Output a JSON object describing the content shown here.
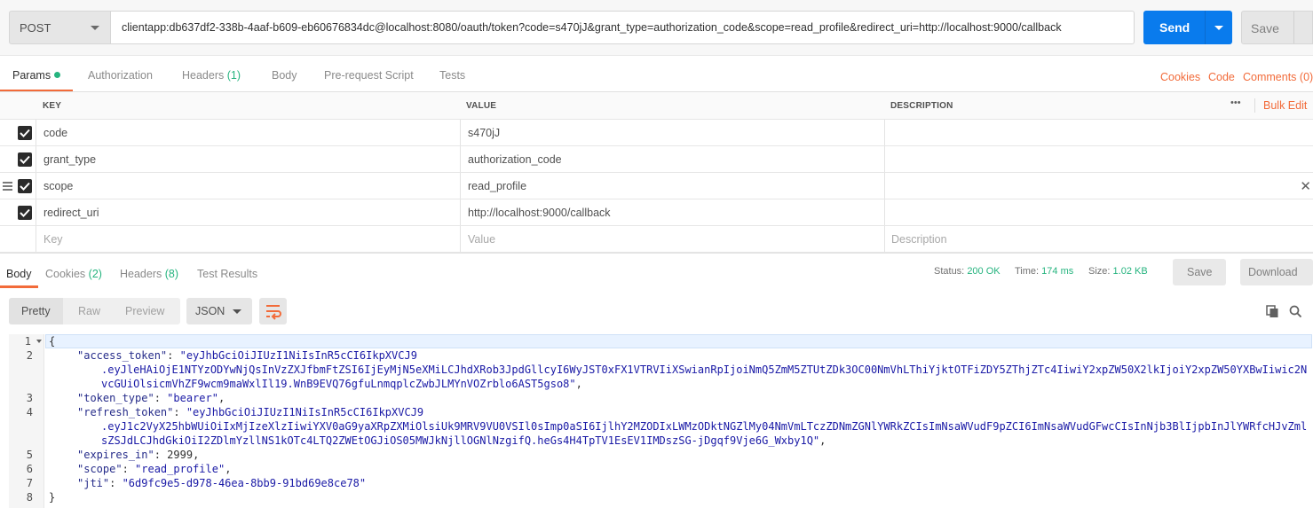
{
  "request": {
    "method": "POST",
    "url": "clientapp:db637df2-338b-4aaf-b609-eb60676834dc@localhost:8080/oauth/token?code=s470jJ&grant_type=authorization_code&scope=read_profile&redirect_uri=http://localhost:9000/callback",
    "send_label": "Send",
    "save_label": "Save"
  },
  "request_tabs": {
    "params": "Params",
    "authorization": "Authorization",
    "headers": "Headers",
    "headers_count": "(1)",
    "body": "Body",
    "prerequest": "Pre-request Script",
    "tests": "Tests"
  },
  "request_links": {
    "cookies": "Cookies",
    "code": "Code",
    "comments": "Comments (0)"
  },
  "params_table": {
    "headers": {
      "key": "KEY",
      "value": "VALUE",
      "description": "DESCRIPTION"
    },
    "bulk_edit": "Bulk Edit",
    "more": "•••",
    "rows": [
      {
        "key": "code",
        "value": "s470jJ"
      },
      {
        "key": "grant_type",
        "value": "authorization_code"
      },
      {
        "key": "scope",
        "value": "read_profile"
      },
      {
        "key": "redirect_uri",
        "value": "http://localhost:9000/callback"
      }
    ],
    "placeholders": {
      "key": "Key",
      "value": "Value",
      "description": "Description"
    }
  },
  "response_tabs": {
    "body": "Body",
    "cookies": "Cookies",
    "cookies_count": "(2)",
    "headers": "Headers",
    "headers_count": "(8)",
    "tests": "Test Results"
  },
  "response_status": {
    "status_label": "Status:",
    "status_value": "200 OK",
    "time_label": "Time:",
    "time_value": "174 ms",
    "size_label": "Size:",
    "size_value": "1.02 KB",
    "save": "Save",
    "download": "Download"
  },
  "view_options": {
    "pretty": "Pretty",
    "raw": "Raw",
    "preview": "Preview",
    "format": "JSON"
  },
  "response_body": {
    "line_numbers": [
      "1",
      "2",
      "3",
      "4",
      "5",
      "6",
      "7",
      "8"
    ],
    "open_brace": "{",
    "close_brace": "}",
    "access_token_key": "\"access_token\"",
    "access_token_l1": "\"eyJhbGciOiJIUzI1NiIsInR5cCI6IkpXVCJ9",
    "access_token_l2": ".eyJleHAiOjE1NTYzODYwNjQsInVzZXJfbmFtZSI6IjEyMjN5eXMiLCJhdXRob3JpdGllcyI6WyJST0xFX1VTRVIiXSwianRpIjoiNmQ5ZmM5ZTUtZDk3OC00NmVhLThiYjktOTFiZDY5ZThjZTc4IiwiY2xpZW50X2lkIjoiY2xpZW50YXBwIiwic2N",
    "access_token_l3": "vcGUiOlsicmVhZF9wcm9maWxlIl19.WnB9EVQ76gfuLnmqplcZwbJLMYnVOZrblo6AST5gso8\"",
    "token_type_key": "\"token_type\"",
    "token_type_val": "\"bearer\"",
    "refresh_token_key": "\"refresh_token\"",
    "refresh_token_l1": "\"eyJhbGciOiJIUzI1NiIsInR5cCI6IkpXVCJ9",
    "refresh_token_l2": ".eyJ1c2VyX25hbWUiOiIxMjIzeXlzIiwiYXV0aG9yaXRpZXMiOlsiUk9MRV9VU0VSIl0sImp0aSI6IjlhY2MZODIxLWMzODktNGZlMy04NmVmLTczZDNmZGNlYWRkZCIsImNsaWVudF9pZCI6ImNsaWVudGFwcCIsInNjb3BlIjpbInJlYWRfcHJvZml",
    "refresh_token_l3": "sZSJdLCJhdGkiOiI2ZDlmYzllNS1kOTc4LTQ2ZWEtOGJiOS05MWJkNjllOGNlNzgifQ.heGs4H4TpTV1EsEV1IMDszSG-jDgqf9Vje6G_Wxby1Q\"",
    "expires_in_key": "\"expires_in\"",
    "expires_in_val": "2999",
    "scope_key": "\"scope\"",
    "scope_val": "\"read_profile\"",
    "jti_key": "\"jti\"",
    "jti_val": "\"6d9fc9e5-d978-46ea-8bb9-91bd69e8ce78\""
  },
  "colors": {
    "accent": "#f26b3a",
    "send": "#097bed",
    "success": "#26b47f"
  }
}
